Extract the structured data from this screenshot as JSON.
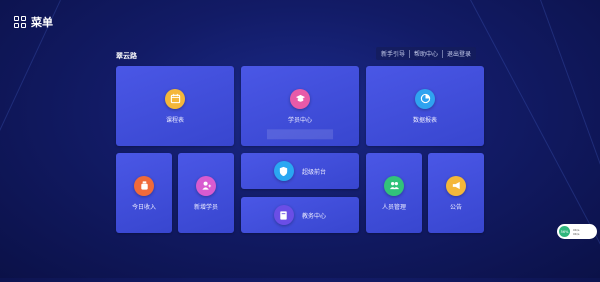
{
  "header": {
    "title": "菜单",
    "menu_icon": "grid-icon"
  },
  "org": {
    "name": "翠云路"
  },
  "links": [
    "新手引导",
    "帮助中心",
    "退出登录"
  ],
  "tiles": [
    {
      "label": "课程表",
      "icon": "calendar-icon",
      "color": "#f4b73a"
    },
    {
      "label": "学员中心",
      "icon": "graduation-cap-icon",
      "color": "#e85aa8"
    },
    {
      "label": "数据报表",
      "icon": "pie-chart-icon",
      "color": "#2fa3f0"
    },
    {
      "label": "今日收入",
      "icon": "money-bag-icon",
      "color": "#f06a3a"
    },
    {
      "label": "新增学员",
      "icon": "add-user-icon",
      "color": "#d85bd0"
    },
    {
      "label": "超级前台",
      "icon": "shield-icon",
      "color": "#2aa7f2"
    },
    {
      "label": "教务中心",
      "icon": "book-icon",
      "color": "#6a4ee6"
    },
    {
      "label": "人员管理",
      "icon": "users-icon",
      "color": "#32c27a"
    },
    {
      "label": "公告",
      "icon": "megaphone-icon",
      "color": "#f4b73a"
    }
  ],
  "widget": {
    "percent": "56%",
    "stat_1": "0K/s",
    "stat_2": "0K/s"
  }
}
